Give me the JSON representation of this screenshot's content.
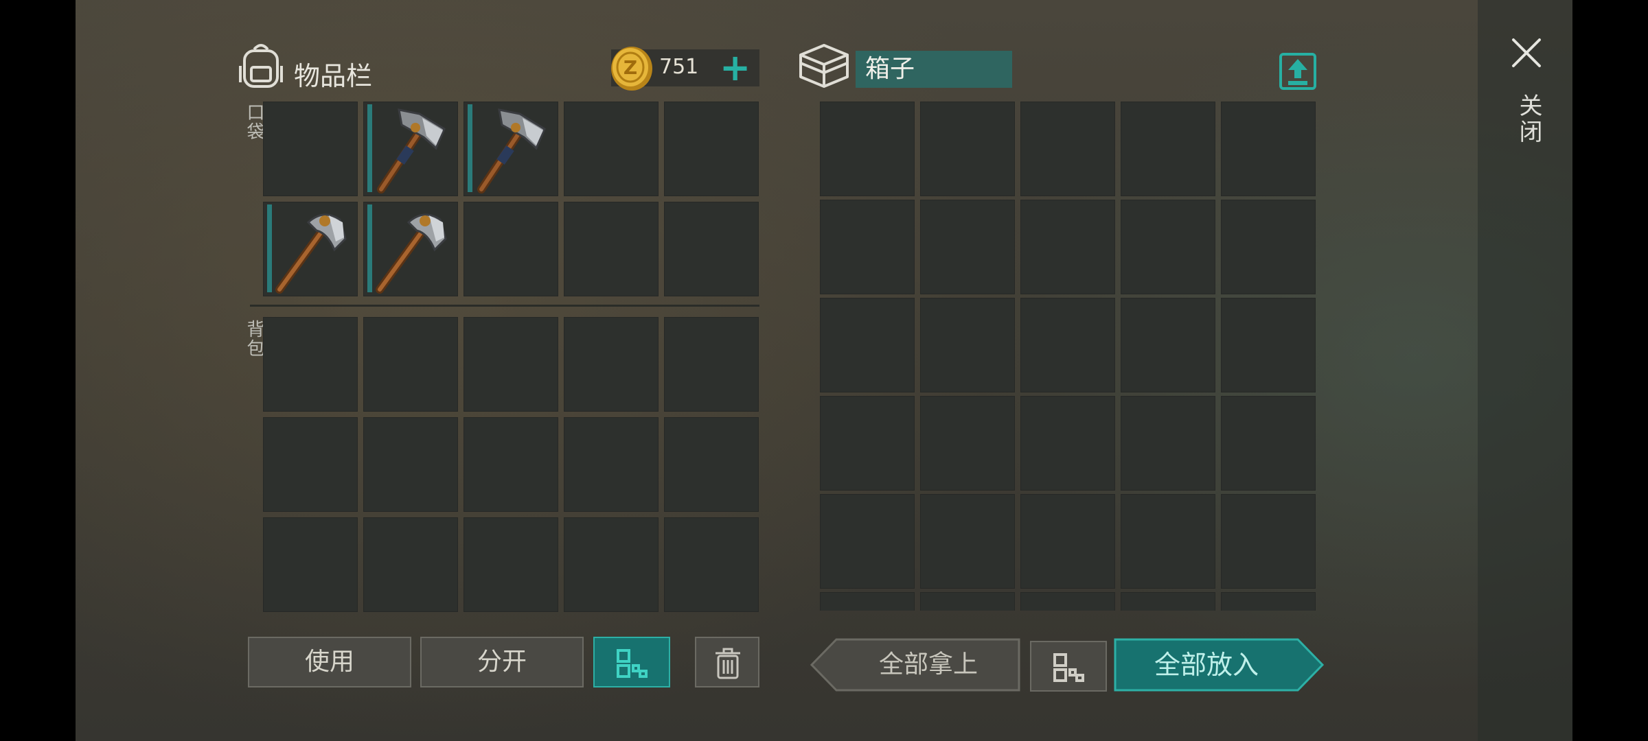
{
  "inventory": {
    "title": "物品栏",
    "pocket_label": "口袋",
    "backpack_label": "背包",
    "coins": "751",
    "pocket_items": [
      {
        "icon": "empty"
      },
      {
        "icon": "hatchet-icon"
      },
      {
        "icon": "hatchet-icon"
      },
      {
        "icon": "empty"
      },
      {
        "icon": "empty"
      },
      {
        "icon": "pickaxe-icon"
      },
      {
        "icon": "pickaxe-icon"
      },
      {
        "icon": "empty"
      },
      {
        "icon": "empty"
      },
      {
        "icon": "empty"
      }
    ]
  },
  "container": {
    "name": "箱子"
  },
  "buttons": {
    "use": "使用",
    "split": "分开",
    "take_all": "全部拿上",
    "put_all": "全部放入",
    "close": "关闭"
  },
  "colors": {
    "accent": "#27b0a3",
    "slot": "#2d302d",
    "slot_marker": "#2a7b7a"
  }
}
